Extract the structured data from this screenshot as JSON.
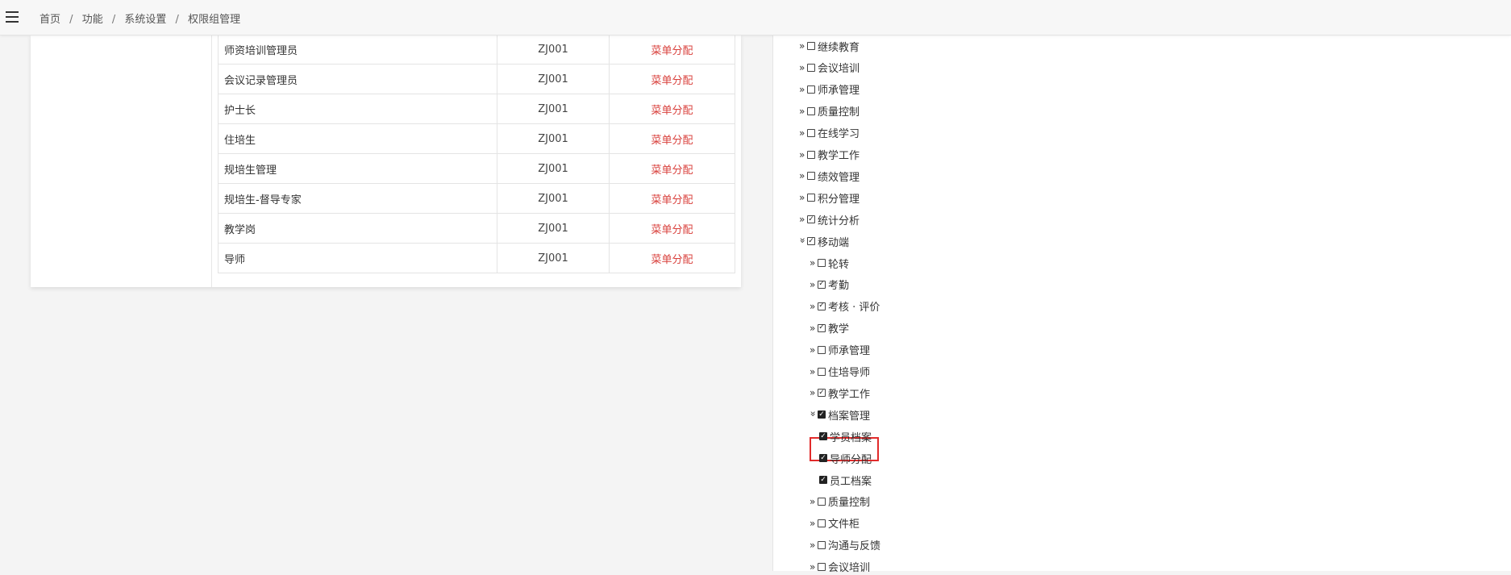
{
  "header": {
    "breadcrumb": [
      "首页",
      "功能",
      "系统设置",
      "权限组管理"
    ],
    "separator": "/"
  },
  "roles": [
    {
      "name": "师资培训管理员",
      "code": "ZJ001",
      "action": "菜单分配"
    },
    {
      "name": "会议记录管理员",
      "code": "ZJ001",
      "action": "菜单分配"
    },
    {
      "name": "护士长",
      "code": "ZJ001",
      "action": "菜单分配"
    },
    {
      "name": "住培生",
      "code": "ZJ001",
      "action": "菜单分配"
    },
    {
      "name": "规培生管理",
      "code": "ZJ001",
      "action": "菜单分配"
    },
    {
      "name": "规培生-督导专家",
      "code": "ZJ001",
      "action": "菜单分配"
    },
    {
      "name": "教学岗",
      "code": "ZJ001",
      "action": "菜单分配"
    },
    {
      "name": "导师",
      "code": "ZJ001",
      "action": "菜单分配"
    }
  ],
  "tree": [
    {
      "label": "继续教育",
      "level": 0,
      "expanded": false,
      "checked": false
    },
    {
      "label": "会议培训",
      "level": 0,
      "expanded": false,
      "checked": false
    },
    {
      "label": "师承管理",
      "level": 0,
      "expanded": false,
      "checked": false
    },
    {
      "label": "质量控制",
      "level": 0,
      "expanded": false,
      "checked": false
    },
    {
      "label": "在线学习",
      "level": 0,
      "expanded": false,
      "checked": false
    },
    {
      "label": "教学工作",
      "level": 0,
      "expanded": false,
      "checked": false
    },
    {
      "label": "绩效管理",
      "level": 0,
      "expanded": false,
      "checked": false
    },
    {
      "label": "积分管理",
      "level": 0,
      "expanded": false,
      "checked": false
    },
    {
      "label": "统计分析",
      "level": 0,
      "expanded": false,
      "checked": true
    },
    {
      "label": "移动端",
      "level": 0,
      "expanded": true,
      "checked": true
    },
    {
      "label": "轮转",
      "level": 1,
      "expanded": false,
      "checked": false
    },
    {
      "label": "考勤",
      "level": 1,
      "expanded": false,
      "checked": true
    },
    {
      "label": "考核 · 评价",
      "level": 1,
      "expanded": false,
      "checked": true
    },
    {
      "label": "教学",
      "level": 1,
      "expanded": false,
      "checked": true
    },
    {
      "label": "师承管理",
      "level": 1,
      "expanded": false,
      "checked": false
    },
    {
      "label": "住培导师",
      "level": 1,
      "expanded": false,
      "checked": false
    },
    {
      "label": "教学工作",
      "level": 1,
      "expanded": false,
      "checked": true
    },
    {
      "label": "档案管理",
      "level": 1,
      "expanded": true,
      "checked": true,
      "filled": true
    },
    {
      "label": "学员档案",
      "level": 2,
      "leaf": true,
      "checked": true,
      "filled": true
    },
    {
      "label": "导师分配",
      "level": 2,
      "leaf": true,
      "checked": true,
      "filled": true,
      "highlighted": true
    },
    {
      "label": "员工档案",
      "level": 2,
      "leaf": true,
      "checked": true,
      "filled": true
    },
    {
      "label": "质量控制",
      "level": 1,
      "expanded": false,
      "checked": false
    },
    {
      "label": "文件柜",
      "level": 1,
      "expanded": false,
      "checked": false
    },
    {
      "label": "沟通与反馈",
      "level": 1,
      "expanded": false,
      "checked": false
    },
    {
      "label": "会议培训",
      "level": 1,
      "expanded": false,
      "checked": false
    }
  ],
  "colors": {
    "action_link": "#d9413d",
    "highlight_border": "#e12b2b"
  }
}
